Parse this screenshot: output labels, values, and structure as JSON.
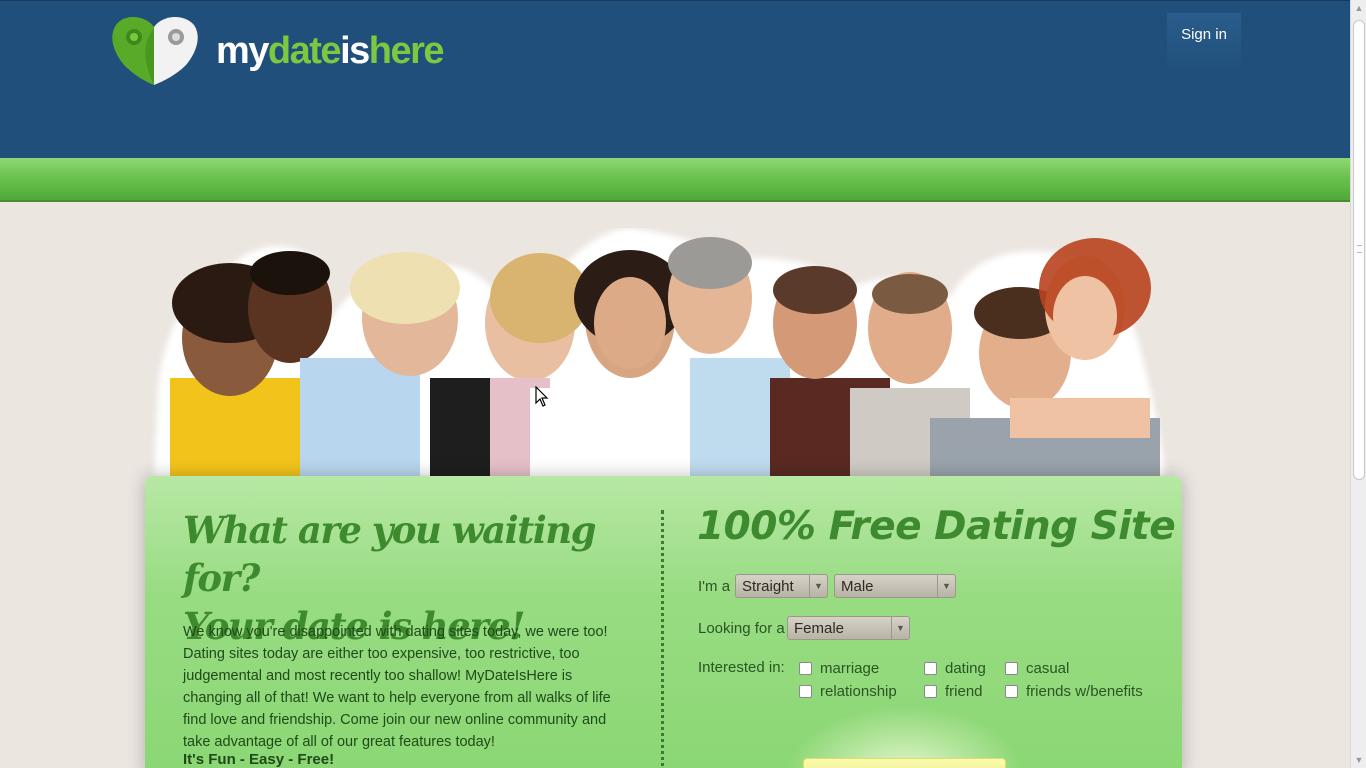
{
  "brand": {
    "name_white_1": "my",
    "name_green": "date",
    "name_white_2": "is",
    "name_green_2": "here",
    "colors": {
      "header": "#204f7b",
      "green": "#7cc840",
      "panel": "#98dc82"
    }
  },
  "nav": {
    "signin_label": "Sign in"
  },
  "hero": {
    "headline_line1": "What are you waiting for?",
    "headline_line2": "Your date is here!",
    "body": "We know you're disappointed with dating sites today, we were too! Dating sites today are either too expensive, too restrictive, too judgemental and most recently too shallow! MyDateIsHere is changing all of that! We want to help everyone from all walks of life find love and friendship. Come join our new online community and take advantage of all of our great features today!",
    "tagline": "It's Fun - Easy - Free!"
  },
  "form": {
    "title": "100% Free Dating Site",
    "im_a_label": "I'm a",
    "orientation_value": "Straight",
    "gender_value": "Male",
    "looking_label": "Looking for a",
    "looking_value": "Female",
    "interested_label": "Interested in:",
    "options": {
      "marriage": "marriage",
      "dating": "dating",
      "casual": "casual",
      "relationship": "relationship",
      "friend": "friend",
      "friends_benefits": "friends w/benefits"
    }
  },
  "icons": [
    "location-heart-logo-icon",
    "dropdown-arrow-icon",
    "mouse-cursor-icon"
  ]
}
